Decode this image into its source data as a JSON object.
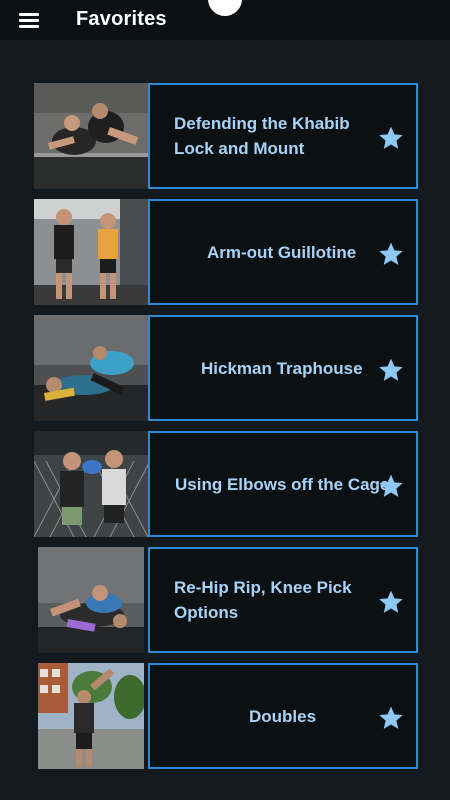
{
  "header": {
    "title": "Favorites",
    "menu_icon": "hamburger-menu-icon"
  },
  "colors": {
    "background": "#131a1f",
    "panel_bg": "#0b1013",
    "border": "#2d88d8",
    "text": "#a8d3f7",
    "star": "#8ec9f5"
  },
  "favorites": [
    {
      "title_lines": [
        "Defending the Khabib",
        "Lock and Mount"
      ],
      "icon": "star-icon"
    },
    {
      "title_lines": [
        "Arm-out Guillotine"
      ],
      "icon": "star-icon"
    },
    {
      "title_lines": [
        "Hickman Traphouse"
      ],
      "icon": "star-icon"
    },
    {
      "title_lines": [
        "Using Elbows off the Cage"
      ],
      "icon": "star-icon"
    },
    {
      "title_lines": [
        "Re-Hip Rip, Knee Pick",
        "Options"
      ],
      "icon": "star-icon"
    },
    {
      "title_lines": [
        "Doubles"
      ],
      "icon": "star-icon"
    }
  ]
}
